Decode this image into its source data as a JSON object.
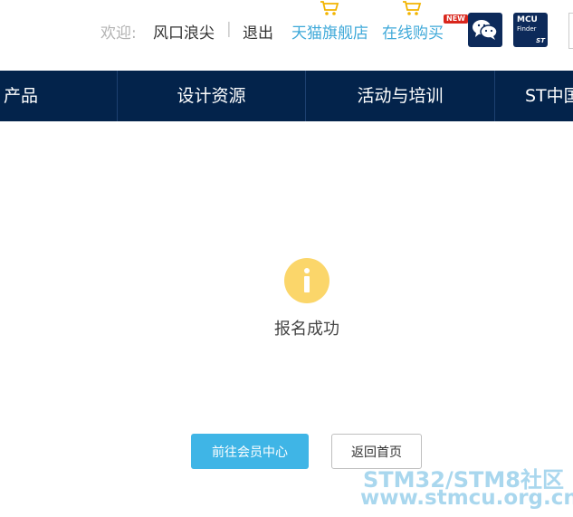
{
  "header": {
    "welcome_label": "欢迎:",
    "username": "风口浪尖",
    "separator": "|",
    "logout_label": "退出",
    "tmall_store_label": "天猫旗舰店",
    "online_purchase_label": "在线购买",
    "new_badge": "NEW",
    "wechat_icon": "wechat-icon",
    "mcu_finder": {
      "line1": "MCU",
      "line2": "Finder",
      "brand": "ST"
    }
  },
  "nav": {
    "items": [
      {
        "label": "产品"
      },
      {
        "label": "设计资源"
      },
      {
        "label": "活动与培训"
      },
      {
        "label": "ST中国"
      }
    ]
  },
  "main": {
    "icon": "info-icon",
    "message": "报名成功",
    "primary_button": "前往会员中心",
    "secondary_button": "返回首页"
  },
  "watermark": {
    "line1": "STM32/STM8社区",
    "line2": "www.stmcu.org.cn"
  },
  "colors": {
    "nav_bg": "#03234b",
    "link": "#3fa9d9",
    "primary": "#3fb5e6",
    "icon_yellow": "#fbd66a",
    "badge_red": "#d9261c"
  }
}
